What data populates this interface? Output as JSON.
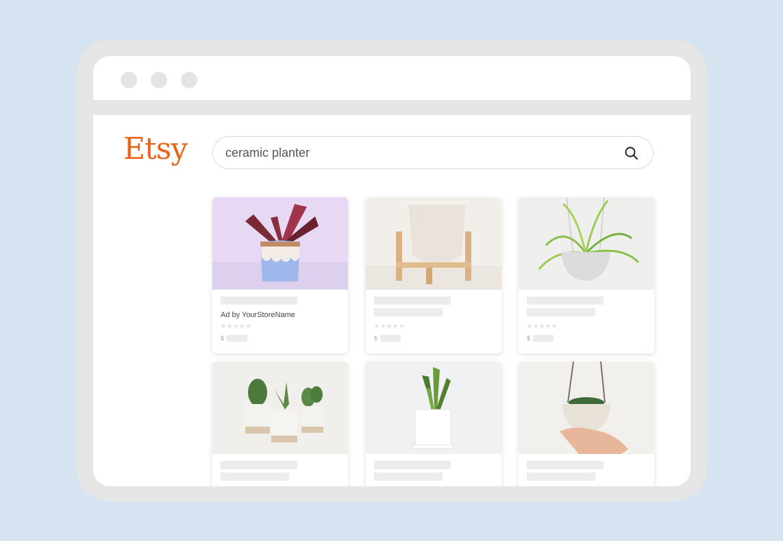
{
  "brand": {
    "name": "Etsy",
    "color": "#e8651a"
  },
  "search": {
    "value": "ceramic planter",
    "icon": "search-icon"
  },
  "listings": [
    {
      "ad_label": "Ad by YourStoreName",
      "rating_stars": "★★★★★",
      "price_symbol": "$",
      "image": "croton plant in drip-glaze pot"
    },
    {
      "ad_label": "",
      "rating_stars": "★★★★★",
      "price_symbol": "$",
      "image": "white planter on wooden stand"
    },
    {
      "ad_label": "",
      "rating_stars": "★★★★★",
      "price_symbol": "$",
      "image": "spider plant in hanging pot"
    },
    {
      "image": "three cacti in speckled pots"
    },
    {
      "image": "snake plant in white square pot"
    },
    {
      "image": "succulent in hanging rope bowl"
    }
  ]
}
